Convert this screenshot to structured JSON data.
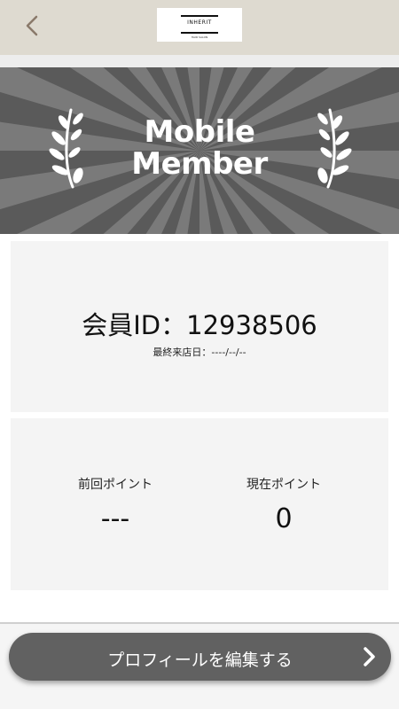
{
  "header": {
    "logo_text": "INHERIT",
    "logo_subtext": "HAIR SALON"
  },
  "banner": {
    "title_line1": "Mobile",
    "title_line2": "Member"
  },
  "member": {
    "id_text": "会員ID：12938506",
    "last_visit_text": "最終来店日：----/--/--"
  },
  "points": {
    "previous_label": "前回ポイント",
    "previous_value": "---",
    "current_label": "現在ポイント",
    "current_value": "0"
  },
  "actions": {
    "edit_profile_label": "プロフィールを編集する"
  },
  "colors": {
    "header_bg": "#dedad0",
    "banner_bg": "#5a5a5a",
    "button_bg": "#616161",
    "back_arrow": "#8a7a6a"
  }
}
